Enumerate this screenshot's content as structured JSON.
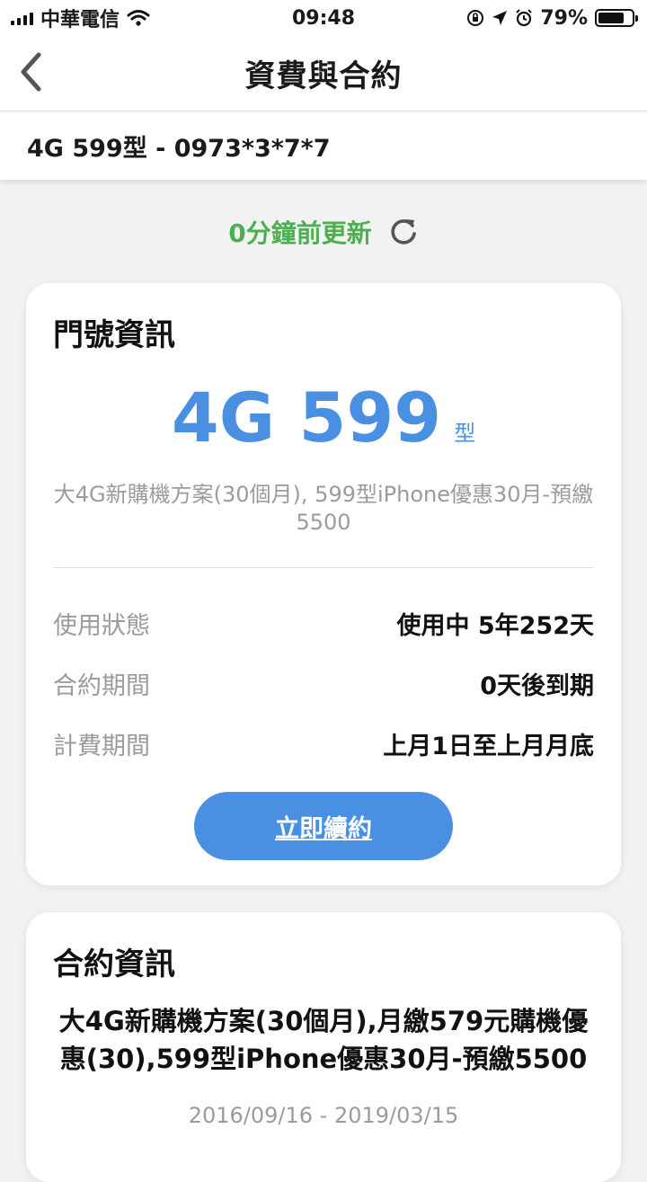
{
  "status_bar": {
    "carrier": "中華電信",
    "time": "09:48",
    "battery_text": "79%",
    "battery_level": 0.79,
    "icons": [
      "signal-icon",
      "wifi-icon",
      "orientation-lock-icon",
      "location-icon",
      "alarm-icon",
      "battery-icon"
    ]
  },
  "nav": {
    "title": "資費與合約",
    "back_icon": "chevron-left-icon"
  },
  "plan_selector": {
    "text": "4G 599型 - 0973*3*7*7"
  },
  "update": {
    "text": "0分鐘前更新",
    "icon": "refresh-icon",
    "color": "#4caf50"
  },
  "number_info": {
    "title": "門號資訊",
    "plan_name": "4G 599",
    "plan_suffix": "型",
    "plan_description": "大4G新購機方案(30個月), 599型iPhone優惠30月-預繳5500",
    "rows": [
      {
        "label": "使用狀態",
        "value": "使用中 5年252天"
      },
      {
        "label": "合約期間",
        "value": "0天後到期"
      },
      {
        "label": "計費期間",
        "value": "上月1日至上月月底"
      }
    ],
    "renew_button": "立即續約",
    "accent_color": "#4a90e2"
  },
  "contract_info": {
    "title": "合約資訊",
    "description": "大4G新購機方案(30個月),月繳579元購機優惠(30),599型iPhone優惠30月-預繳5500",
    "date_range": "2016/09/16 - 2019/03/15"
  }
}
